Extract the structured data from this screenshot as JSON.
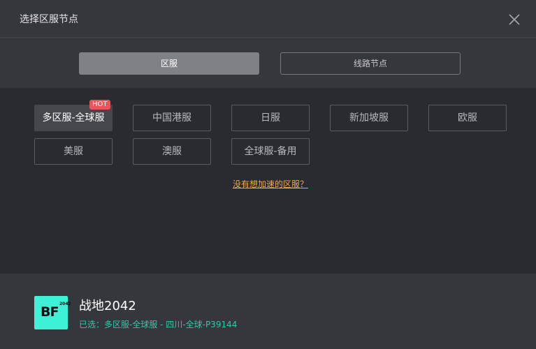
{
  "window": {
    "title": "选择区服节点"
  },
  "tabs": [
    {
      "label": "区服",
      "active": true
    },
    {
      "label": "线路节点",
      "active": false
    }
  ],
  "servers": [
    {
      "label": "多区服-全球服",
      "selected": true,
      "badge": "HOT"
    },
    {
      "label": "中国港服",
      "selected": false
    },
    {
      "label": "日服",
      "selected": false
    },
    {
      "label": "新加坡服",
      "selected": false
    },
    {
      "label": "欧服",
      "selected": false
    },
    {
      "label": "美服",
      "selected": false
    },
    {
      "label": "澳服",
      "selected": false
    },
    {
      "label": "全球服-备用",
      "selected": false
    }
  ],
  "missing_region_link": "没有想加速的区服？",
  "footer": {
    "logo_text": "BF",
    "logo_sub": "2042",
    "game_name": "战地2042",
    "selected_label": "已选：多区服-全球服 - 四川-全球-P39144"
  },
  "colors": {
    "accent_link": "#f0a848",
    "selected_text": "#2ec9a8",
    "hot_badge": "#e8555a",
    "logo_bg": "#3ff2d7"
  }
}
